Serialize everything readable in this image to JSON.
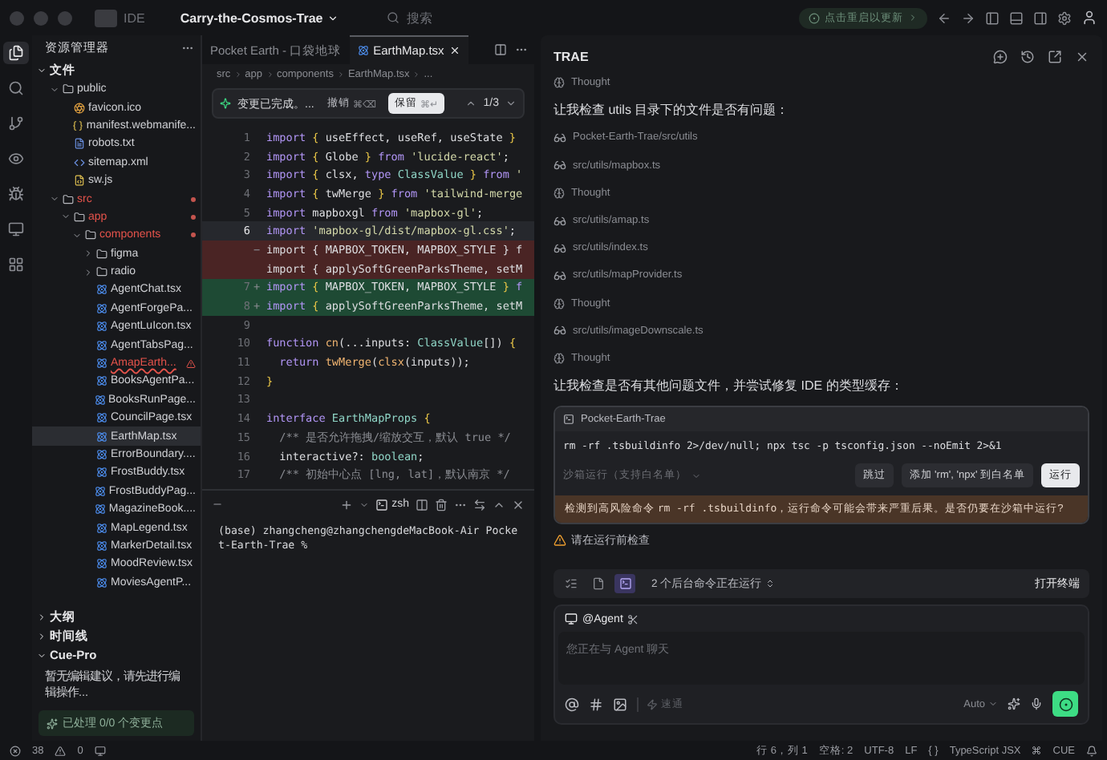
{
  "titlebar": {
    "mode": "IDE",
    "project": "Carry-the-Cosmos-Trae",
    "search_placeholder": "搜索",
    "update": "点击重启以更新"
  },
  "activity_bar": [
    {
      "kind": "files",
      "selected": true
    },
    {
      "kind": "search",
      "selected": false
    },
    {
      "kind": "git",
      "selected": false
    },
    {
      "kind": "preview",
      "selected": false
    },
    {
      "kind": "debug",
      "selected": false
    },
    {
      "kind": "remote",
      "selected": false
    },
    {
      "kind": "extensions",
      "selected": false
    }
  ],
  "sidebar": {
    "title": "资源管理器",
    "sections": [
      {
        "title": "文件",
        "expanded": true,
        "tree": [
          {
            "name": "public",
            "kind": "folder",
            "expanded": true,
            "modified": false,
            "selected": false,
            "children": [
              {
                "name": "favicon.ico",
                "kind": "ico",
                "modified": false,
                "selected": false
              },
              {
                "name": "manifest.webmanife...",
                "kind": "json",
                "modified": false,
                "selected": false
              },
              {
                "name": "robots.txt",
                "kind": "txt",
                "modified": false,
                "selected": false
              },
              {
                "name": "sitemap.xml",
                "kind": "xml",
                "modified": false,
                "selected": false
              },
              {
                "name": "sw.js",
                "kind": "js",
                "modified": false,
                "selected": false
              }
            ]
          },
          {
            "name": "src",
            "kind": "folder",
            "expanded": true,
            "modified": true,
            "selected": false,
            "children": [
              {
                "name": "app",
                "kind": "folder",
                "expanded": true,
                "modified": true,
                "selected": false,
                "children": [
                  {
                    "name": "components",
                    "kind": "folder",
                    "expanded": true,
                    "modified": true,
                    "selected": false,
                    "children": [
                      {
                        "name": "figma",
                        "kind": "folder",
                        "expanded": false,
                        "modified": false,
                        "selected": false
                      },
                      {
                        "name": "radio",
                        "kind": "folder",
                        "expanded": false,
                        "modified": false,
                        "selected": false
                      },
                      {
                        "name": "AgentChat.tsx",
                        "kind": "tsx",
                        "modified": false,
                        "selected": false
                      },
                      {
                        "name": "AgentForgePa...",
                        "kind": "tsx",
                        "modified": false,
                        "selected": false
                      },
                      {
                        "name": "AgentLuIcon.tsx",
                        "kind": "tsx",
                        "modified": false,
                        "selected": false
                      },
                      {
                        "name": "AgentTabsPag...",
                        "kind": "tsx",
                        "modified": false,
                        "selected": false
                      },
                      {
                        "name": "AmapEarth...",
                        "kind": "tsx",
                        "modified": true,
                        "error": true,
                        "selected": false
                      },
                      {
                        "name": "BooksAgentPa...",
                        "kind": "tsx",
                        "modified": false,
                        "selected": false
                      },
                      {
                        "name": "BooksRunPage...",
                        "kind": "tsx",
                        "modified": false,
                        "selected": false
                      },
                      {
                        "name": "CouncilPage.tsx",
                        "kind": "tsx",
                        "modified": false,
                        "selected": false
                      },
                      {
                        "name": "EarthMap.tsx",
                        "kind": "tsx",
                        "modified": false,
                        "selected": true
                      },
                      {
                        "name": "ErrorBoundary....",
                        "kind": "tsx",
                        "modified": false,
                        "selected": false
                      },
                      {
                        "name": "FrostBuddy.tsx",
                        "kind": "tsx",
                        "modified": false,
                        "selected": false
                      },
                      {
                        "name": "FrostBuddyPag...",
                        "kind": "tsx",
                        "modified": false,
                        "selected": false
                      },
                      {
                        "name": "MagazineBook....",
                        "kind": "tsx",
                        "modified": false,
                        "selected": false
                      },
                      {
                        "name": "MapLegend.tsx",
                        "kind": "tsx",
                        "modified": false,
                        "selected": false
                      },
                      {
                        "name": "MarkerDetail.tsx",
                        "kind": "tsx",
                        "modified": false,
                        "selected": false
                      },
                      {
                        "name": "MoodReview.tsx",
                        "kind": "tsx",
                        "modified": false,
                        "selected": false
                      },
                      {
                        "name": "MoviesAgentP...",
                        "kind": "tsx",
                        "modified": false,
                        "selected": false
                      }
                    ]
                  }
                ]
              }
            ]
          }
        ]
      },
      {
        "title": "大纲",
        "expanded": false
      },
      {
        "title": "时间线",
        "expanded": false
      },
      {
        "title": "Cue-Pro",
        "expanded": true,
        "message": "暂无编辑建议，请先进行编辑操作...",
        "status": "已处理 0/0 个变更点"
      }
    ]
  },
  "editor": {
    "tabs": [
      {
        "label": "Pocket Earth - 口袋地球",
        "selected": false
      },
      {
        "label": "EarthMap.tsx",
        "selected": true
      }
    ],
    "breadcrumbs": [
      "src",
      "app",
      "components",
      "EarthMap.tsx",
      "..."
    ],
    "diff_bar": {
      "message": "变更已完成。...",
      "undo": "撤销",
      "undo_shortcut": "⌘⌫",
      "keep": "保留",
      "keep_shortcut": "⌘↵",
      "counter": "1/3"
    },
    "lines": [
      {
        "number": "1",
        "kind": "normal",
        "tokens": [
          {
            "t": "import",
            "kind": "kw"
          },
          {
            "t": " { ",
            "kind": "br"
          },
          {
            "t": "useEffect, useRef, useState ",
            "kind": "id"
          },
          {
            "t": "}",
            "kind": "br"
          }
        ]
      },
      {
        "number": "2",
        "kind": "normal",
        "tokens": [
          {
            "t": "import",
            "kind": "kw"
          },
          {
            "t": " { ",
            "kind": "br"
          },
          {
            "t": "Globe ",
            "kind": "id"
          },
          {
            "t": "} ",
            "kind": "br"
          },
          {
            "t": "from ",
            "kind": "kw"
          },
          {
            "t": "'lucide-react'",
            "kind": "str"
          },
          {
            "t": ";",
            "kind": "id"
          }
        ]
      },
      {
        "number": "3",
        "kind": "normal",
        "tokens": [
          {
            "t": "import",
            "kind": "kw"
          },
          {
            "t": " { ",
            "kind": "br"
          },
          {
            "t": "clsx, ",
            "kind": "id"
          },
          {
            "t": "type ",
            "kind": "kw"
          },
          {
            "t": "ClassValue ",
            "kind": "ty"
          },
          {
            "t": "} ",
            "kind": "br"
          },
          {
            "t": "from ",
            "kind": "kw"
          },
          {
            "t": "'",
            "kind": "str"
          }
        ]
      },
      {
        "number": "4",
        "kind": "normal",
        "tokens": [
          {
            "t": "import",
            "kind": "kw"
          },
          {
            "t": " { ",
            "kind": "br"
          },
          {
            "t": "twMerge ",
            "kind": "id"
          },
          {
            "t": "} ",
            "kind": "br"
          },
          {
            "t": "from ",
            "kind": "kw"
          },
          {
            "t": "'tailwind-merge",
            "kind": "str"
          }
        ]
      },
      {
        "number": "5",
        "kind": "normal",
        "tokens": [
          {
            "t": "import ",
            "kind": "kw"
          },
          {
            "t": "mapboxgl ",
            "kind": "id"
          },
          {
            "t": "from ",
            "kind": "kw"
          },
          {
            "t": "'mapbox-gl'",
            "kind": "str"
          },
          {
            "t": ";",
            "kind": "id"
          }
        ]
      },
      {
        "number": "6",
        "kind": "current",
        "tokens": [
          {
            "t": "import ",
            "kind": "kw"
          },
          {
            "t": "'mapbox-gl/dist/mapbox-gl.css'",
            "kind": "str"
          },
          {
            "t": ";",
            "kind": "id"
          }
        ]
      },
      {
        "marker": "−",
        "kind": "removed",
        "tokens": [
          {
            "t": "import { MAPBOX_TOKEN, MAPBOX_STYLE } f",
            "kind": "id"
          }
        ]
      },
      {
        "kind": "removed",
        "tokens": [
          {
            "t": "import { applySoftGreenParksTheme, setM",
            "kind": "id"
          }
        ]
      },
      {
        "number": "7",
        "marker": "+",
        "kind": "added",
        "tokens": [
          {
            "t": "import",
            "kind": "kw"
          },
          {
            "t": " { ",
            "kind": "br"
          },
          {
            "t": "MAPBOX_TOKEN, MAPBOX_STYLE ",
            "kind": "id"
          },
          {
            "t": "} ",
            "kind": "br"
          },
          {
            "t": "f",
            "kind": "kw"
          }
        ]
      },
      {
        "number": "8",
        "marker": "+",
        "kind": "added",
        "tokens": [
          {
            "t": "import",
            "kind": "kw"
          },
          {
            "t": " { ",
            "kind": "br"
          },
          {
            "t": "applySoftGreenParksTheme, setM",
            "kind": "id"
          }
        ]
      },
      {
        "number": "9",
        "kind": "normal"
      },
      {
        "number": "10",
        "kind": "normal",
        "tokens": [
          {
            "t": "function ",
            "kind": "kw"
          },
          {
            "t": "cn",
            "kind": "fn"
          },
          {
            "t": "(...inputs: ",
            "kind": "id"
          },
          {
            "t": "ClassValue",
            "kind": "ty"
          },
          {
            "t": "[]) ",
            "kind": "id"
          },
          {
            "t": "{",
            "kind": "br"
          }
        ]
      },
      {
        "number": "11",
        "kind": "normal",
        "tokens": [
          {
            "t": "  return ",
            "kind": "kw"
          },
          {
            "t": "twMerge",
            "kind": "fn"
          },
          {
            "t": "(",
            "kind": "id"
          },
          {
            "t": "clsx",
            "kind": "fn"
          },
          {
            "t": "(inputs));",
            "kind": "id"
          }
        ]
      },
      {
        "number": "12",
        "kind": "normal",
        "tokens": [
          {
            "t": "}",
            "kind": "br"
          }
        ]
      },
      {
        "number": "13",
        "kind": "normal"
      },
      {
        "number": "14",
        "kind": "normal",
        "tokens": [
          {
            "t": "interface ",
            "kind": "kw"
          },
          {
            "t": "EarthMapProps ",
            "kind": "ty"
          },
          {
            "t": "{",
            "kind": "br"
          }
        ]
      },
      {
        "number": "15",
        "kind": "normal",
        "tokens": [
          {
            "t": "  /** 是否允许拖拽/缩放交互，默认 true */",
            "kind": "cm"
          }
        ]
      },
      {
        "number": "16",
        "kind": "normal",
        "tokens": [
          {
            "t": "  interactive?: ",
            "kind": "id"
          },
          {
            "t": "boolean",
            "kind": "ty"
          },
          {
            "t": ";",
            "kind": "id"
          }
        ]
      },
      {
        "number": "17",
        "kind": "normal",
        "tokens": [
          {
            "t": "  /** 初始中心点 [lng, lat]，默认南京 */",
            "kind": "cm"
          }
        ]
      }
    ]
  },
  "terminal": {
    "shell": "zsh",
    "output": "(base) zhangcheng@zhangchengdeMacBook-Air Pocket-Earth-Trae %"
  },
  "chat": {
    "title": "TRAE",
    "messages": [
      {
        "kind": "thought",
        "text": "Thought"
      },
      {
        "kind": "text",
        "text": "让我检查 utils 目录下的文件是否有问题："
      },
      {
        "kind": "file",
        "text": "Pocket-Earth-Trae/src/utils"
      },
      {
        "kind": "file",
        "text": "src/utils/mapbox.ts"
      },
      {
        "kind": "thought",
        "text": "Thought"
      },
      {
        "kind": "file",
        "text": "src/utils/amap.ts"
      },
      {
        "kind": "file",
        "text": "src/utils/index.ts"
      },
      {
        "kind": "file",
        "text": "src/utils/mapProvider.ts"
      },
      {
        "kind": "thought",
        "text": "Thought"
      },
      {
        "kind": "file",
        "text": "src/utils/imageDownscale.ts"
      },
      {
        "kind": "thought",
        "text": "Thought"
      },
      {
        "kind": "text",
        "text": "让我检查是否有其他问题文件，并尝试修复 IDE 的类型缓存："
      }
    ],
    "command_card": {
      "title": "Pocket-Earth-Trae",
      "command": "rm -rf .tsbuildinfo 2>/dev/null; npx tsc -p tsconfig.json --noEmit 2>&1",
      "sandbox": "沙箱运行（支持白名单）",
      "buttons": [
        {
          "label": "跳过",
          "primary": false
        },
        {
          "label": "添加 'rm', 'npx' 到白名单",
          "primary": false
        },
        {
          "label": "运行",
          "primary": true
        }
      ],
      "warning_before": "检测到高风险命令 ",
      "warning_code": "rm -rf .tsbuildinfo",
      "warning_after": "，运行命令可能会带来严重后果。是否仍要在沙箱中运行?"
    },
    "notice": "请在运行前检查",
    "background": {
      "tabs": [
        {
          "kind": "list",
          "selected": false
        },
        {
          "kind": "file",
          "selected": false
        },
        {
          "kind": "terminal",
          "selected": true
        }
      ],
      "label": "2 个后台命令正在运行",
      "action": "打开终端"
    },
    "composer": {
      "agent": "@Agent",
      "placeholder": "您正在与 Agent 聊天",
      "mode": "速通",
      "model": "Auto"
    }
  },
  "status_bar": {
    "errors": "38",
    "warnings": "0",
    "items": [
      "行 6，列 1",
      "空格: 2",
      "UTF-8",
      "LF",
      "{ }",
      "TypeScript JSX"
    ],
    "cue": "CUE"
  }
}
